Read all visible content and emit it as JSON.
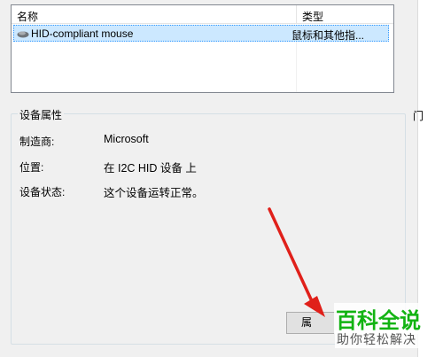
{
  "device_list": {
    "columns": {
      "name": "名称",
      "type": "类型"
    },
    "rows": [
      {
        "icon": "mouse-icon",
        "name": "HID-compliant mouse",
        "type": "鼠标和其他指..."
      }
    ]
  },
  "device_properties": {
    "title": "设备属性",
    "manufacturer": {
      "label": "制造商:",
      "value": "Microsoft"
    },
    "location": {
      "label": "位置:",
      "value": "在 I2C HID 设备 上"
    },
    "status": {
      "label": "设备状态:",
      "value": "这个设备运转正常。"
    }
  },
  "buttons": {
    "properties": "属"
  },
  "edge_text": "门",
  "watermark": {
    "main": "百科全说",
    "sub": "助你轻松解决"
  },
  "colors": {
    "selection": "#cce8ff",
    "arrow": "#e0201a",
    "watermark": "#12b312"
  }
}
